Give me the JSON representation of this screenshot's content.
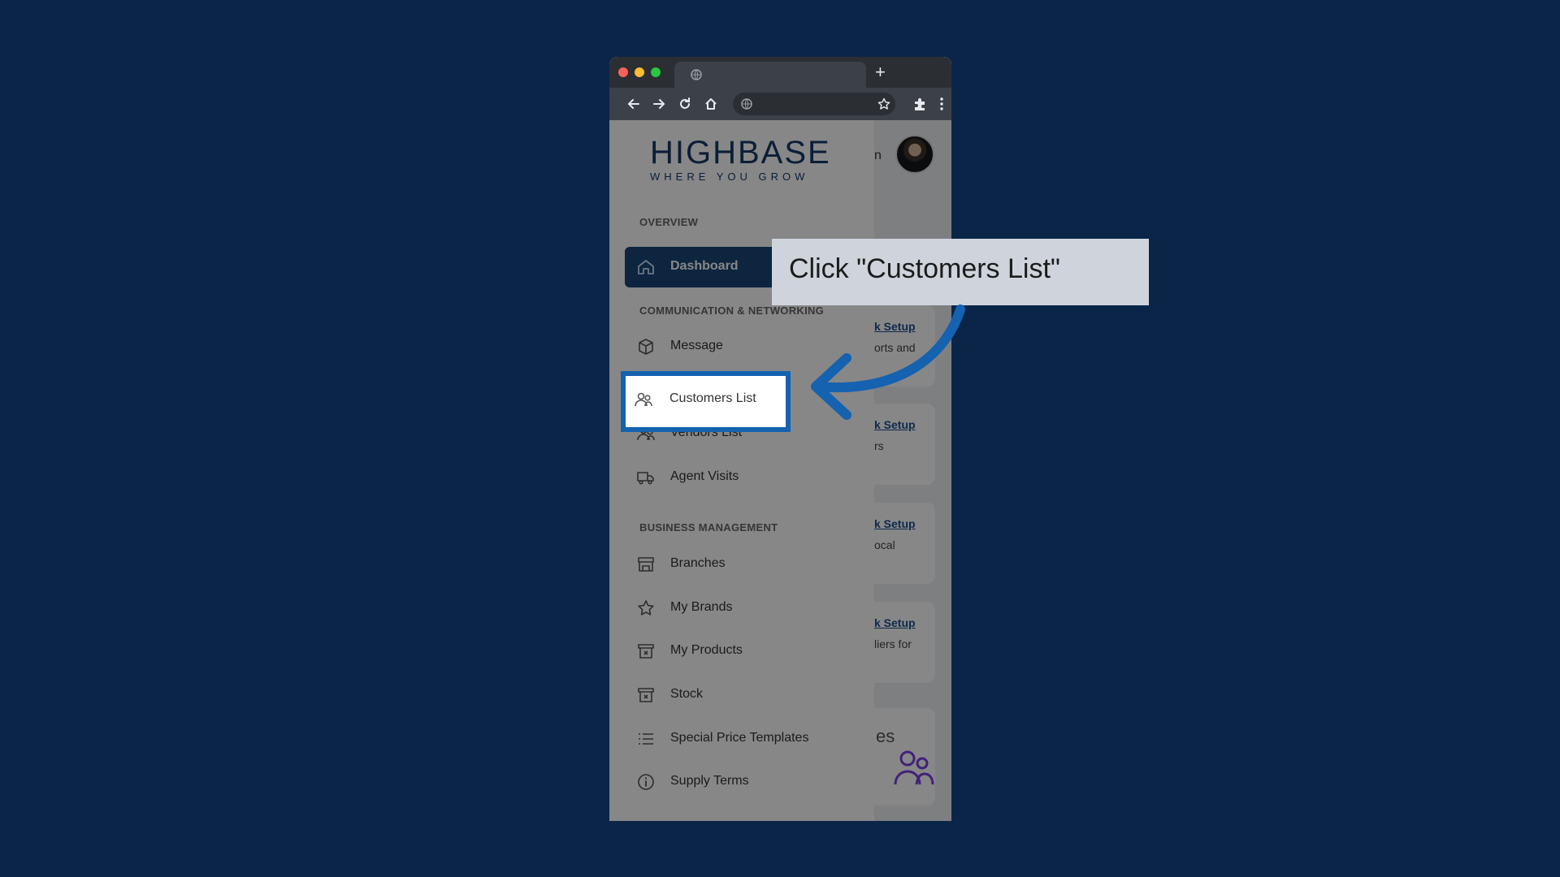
{
  "browser": {
    "new_tab_symbol": "+",
    "toolbar_icons": [
      "back-icon",
      "forward-icon",
      "reload-icon",
      "home-icon",
      "star-icon",
      "extensions-icon",
      "menu-icon"
    ]
  },
  "app": {
    "logo_main": "HIGHBASE",
    "logo_sub": "WHERE YOU GROW",
    "user_name_partial": "n"
  },
  "sidebar": {
    "sections": {
      "overview": "OVERVIEW",
      "communication": "COMMUNICATION & NETWORKING",
      "business": "BUSINESS MANAGEMENT"
    },
    "items": [
      {
        "label": "Dashboard",
        "icon": "home-icon",
        "active": true
      },
      {
        "label": "Message",
        "icon": "box-icon"
      },
      {
        "label": "Customers List",
        "icon": "users-icon"
      },
      {
        "label": "Vendors List",
        "icon": "users-icon"
      },
      {
        "label": "Agent Visits",
        "icon": "truck-icon"
      },
      {
        "label": "Branches",
        "icon": "store-icon"
      },
      {
        "label": "My Brands",
        "icon": "star-icon"
      },
      {
        "label": "My Products",
        "icon": "archive-icon"
      },
      {
        "label": "Stock",
        "icon": "archive-icon"
      },
      {
        "label": "Special Price Templates",
        "icon": "list-icon"
      },
      {
        "label": "Supply Terms",
        "icon": "info-icon"
      }
    ]
  },
  "main": {
    "cards": [
      {
        "link": "k Setup",
        "desc": "orts and"
      },
      {
        "link": "k Setup",
        "desc": "rs"
      },
      {
        "link": "k Setup",
        "desc": "ocal"
      },
      {
        "link": "k Setup",
        "desc": "liers for"
      }
    ],
    "bottom_card_label": "es"
  },
  "tutorial": {
    "callout_text": "Click \"Customers List\"",
    "arrow_color": "#1462b0",
    "highlight_color": "#1462b0"
  }
}
